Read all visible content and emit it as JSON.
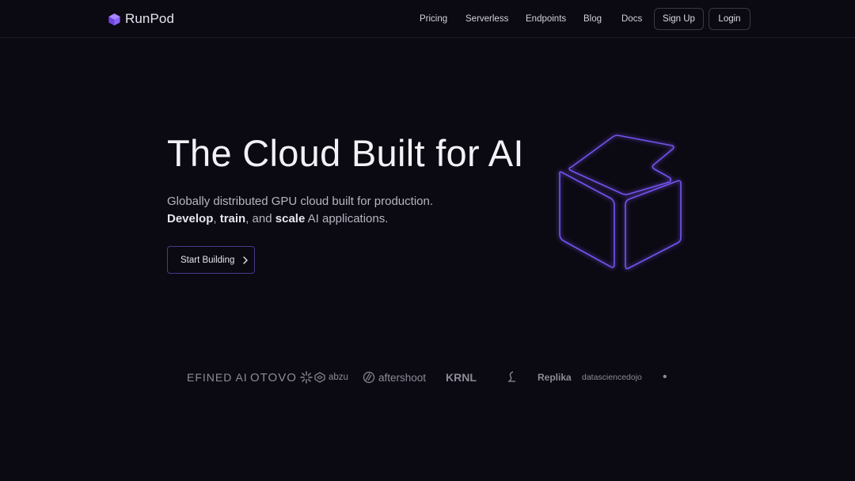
{
  "brand": {
    "name": "RunPod",
    "icon": "runpod-cube-icon",
    "accent": "#7b5cf0"
  },
  "nav": {
    "items": [
      {
        "label": "Pricing"
      },
      {
        "label": "Serverless"
      },
      {
        "label": "Endpoints"
      },
      {
        "label": "Blog"
      },
      {
        "label": "Docs"
      }
    ],
    "signup_label": "Sign Up",
    "login_label": "Login"
  },
  "hero": {
    "title": "The Cloud Built for AI",
    "subtitle_line1": "Globally distributed GPU cloud built for production.",
    "line2": {
      "develop": "Develop",
      "sep1": ",",
      "train": "train",
      "sep2": ", and",
      "scale": "scale",
      "rest": "AI applications."
    },
    "cta_label": "Start Building",
    "cta_icon": "chevron-right-icon",
    "illustration": "glowing-cube-outline",
    "glow_color": "#6a45e6"
  },
  "logos": [
    {
      "name": "EFINED AI"
    },
    {
      "name": "OTOVO"
    },
    {
      "name": "abzu"
    },
    {
      "name": "aftershoot"
    },
    {
      "name": "KRNL"
    },
    {
      "name": "(icon)"
    },
    {
      "name": "Replika"
    },
    {
      "name": "datasciencedojo"
    },
    {
      "name": "•"
    }
  ],
  "colors": {
    "background": "#0b0912",
    "text": "#f2f1f6",
    "muted": "#b7b5c0",
    "border": "#3a3846"
  }
}
